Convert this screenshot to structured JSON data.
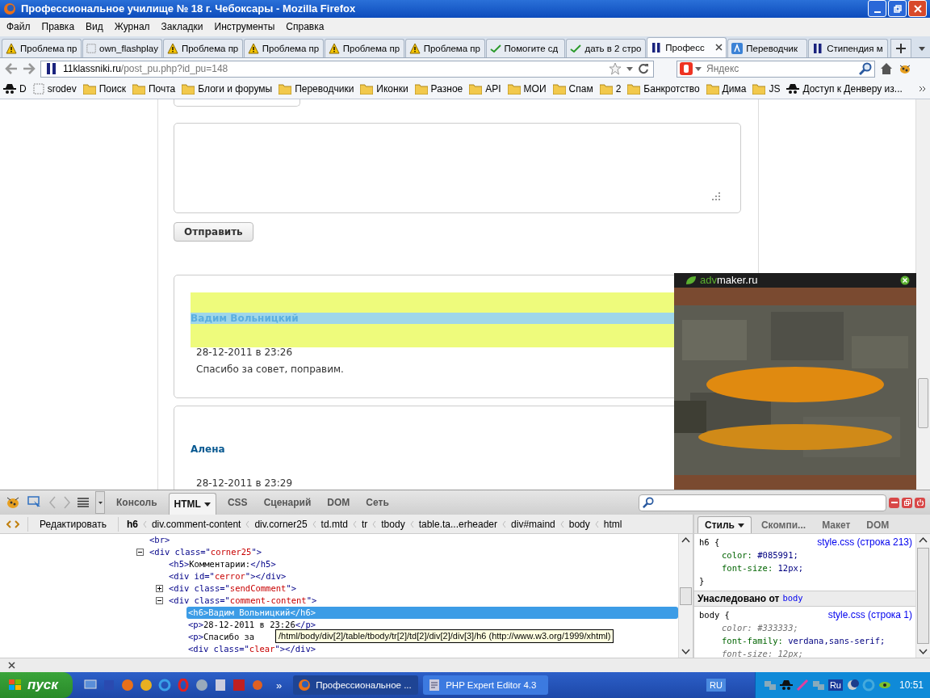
{
  "window": {
    "title": "Профессиональное училище № 18 г. Чебоксары - Mozilla Firefox"
  },
  "menu": [
    "Файл",
    "Правка",
    "Вид",
    "Журнал",
    "Закладки",
    "Инструменты",
    "Справка"
  ],
  "tabs": [
    {
      "label": "Проблема пр",
      "kind": "warning",
      "selected": false
    },
    {
      "label": "own_flashplay",
      "kind": "blank",
      "selected": false
    },
    {
      "label": "Проблема пр",
      "kind": "warning",
      "selected": false
    },
    {
      "label": "Проблема пр",
      "kind": "warning",
      "selected": false
    },
    {
      "label": "Проблема пр",
      "kind": "warning",
      "selected": false
    },
    {
      "label": "Проблема пр",
      "kind": "warning",
      "selected": false
    },
    {
      "label": "Помогите сд",
      "kind": "check",
      "selected": false
    },
    {
      "label": "дать в 2 стро",
      "kind": "check",
      "selected": false
    },
    {
      "label": "Професс",
      "kind": "site",
      "selected": true
    },
    {
      "label": "Переводчик",
      "kind": "translate",
      "selected": false
    },
    {
      "label": "Стипендия м",
      "kind": "site",
      "selected": false
    }
  ],
  "address": {
    "host": "11klassniki.ru",
    "path": "/post_pu.php?id_pu=148"
  },
  "search": {
    "placeholder": "Яндекс"
  },
  "bookmarks": [
    {
      "label": "D",
      "kind": "spy"
    },
    {
      "label": "srodev",
      "kind": "blank"
    },
    {
      "label": "Поиск",
      "kind": "folder"
    },
    {
      "label": "Почта",
      "kind": "folder"
    },
    {
      "label": "Блоги и форумы",
      "kind": "folder"
    },
    {
      "label": "Переводчики",
      "kind": "folder"
    },
    {
      "label": "Иконки",
      "kind": "folder"
    },
    {
      "label": "Разное",
      "kind": "folder"
    },
    {
      "label": "API",
      "kind": "folder"
    },
    {
      "label": "МОИ",
      "kind": "folder"
    },
    {
      "label": "Спам",
      "kind": "folder"
    },
    {
      "label": "2",
      "kind": "folder"
    },
    {
      "label": "Банкротство",
      "kind": "folder"
    },
    {
      "label": "Дима",
      "kind": "folder"
    },
    {
      "label": "JS",
      "kind": "folder"
    },
    {
      "label": "Доступ к Денверу из...",
      "kind": "spy"
    }
  ],
  "page": {
    "send_button": "Отправить",
    "comments": [
      {
        "author": "Вадим Вольницкий",
        "date": "28-12-2011 в 23:26",
        "text": "Спасибо за совет, поправим.",
        "highlighted": true
      },
      {
        "author": "Алена",
        "date": "28-12-2011 в 23:29",
        "highlighted": false
      }
    ],
    "ad": {
      "brand": "adv",
      "domain": "maker.ru",
      "kind": "picture"
    }
  },
  "firebug": {
    "panels": [
      {
        "label": "Консоль",
        "selected": false
      },
      {
        "label": "HTML",
        "selected": true
      },
      {
        "label": "CSS",
        "selected": false
      },
      {
        "label": "Сценарий",
        "selected": false
      },
      {
        "label": "DOM",
        "selected": false
      },
      {
        "label": "Сеть",
        "selected": false
      }
    ],
    "edit_button": "Редактировать",
    "crumbs": [
      {
        "label": "h6",
        "selected": true
      },
      {
        "label": "div.comment-content",
        "selected": false
      },
      {
        "label": "div.corner25",
        "selected": false
      },
      {
        "label": "td.mtd",
        "selected": false
      },
      {
        "label": "tr",
        "selected": false
      },
      {
        "label": "tbody",
        "selected": false
      },
      {
        "label": "table.ta...erheader",
        "selected": false
      },
      {
        "label": "div#maind",
        "selected": false
      },
      {
        "label": "body",
        "selected": false
      },
      {
        "label": "html",
        "selected": false
      }
    ],
    "tree": [
      {
        "parts": [
          {
            "kind": "tag",
            "text": "<br>"
          }
        ],
        "selected": false
      },
      {
        "parts": [
          {
            "kind": "tag",
            "text": "<div class=\""
          },
          {
            "kind": "value",
            "text": "corner25"
          },
          {
            "kind": "tag",
            "text": "\">"
          }
        ],
        "expanded": true,
        "selected": false,
        "children": [
          {
            "parts": [
              {
                "kind": "tag",
                "text": "<h5>"
              },
              {
                "kind": "text",
                "text": "Комментарии:"
              },
              {
                "kind": "tag",
                "text": "</h5>"
              }
            ],
            "selected": false
          },
          {
            "parts": [
              {
                "kind": "tag",
                "text": "<div id=\""
              },
              {
                "kind": "value",
                "text": "cerror"
              },
              {
                "kind": "tag",
                "text": "\"></div>"
              }
            ],
            "selected": false
          },
          {
            "parts": [
              {
                "kind": "tag",
                "text": "<div class=\""
              },
              {
                "kind": "value",
                "text": "sendComment"
              },
              {
                "kind": "tag",
                "text": "\">"
              }
            ],
            "expanded": false,
            "selected": false
          },
          {
            "parts": [
              {
                "kind": "tag",
                "text": "<div class=\""
              },
              {
                "kind": "value",
                "text": "comment-content"
              },
              {
                "kind": "tag",
                "text": "\">"
              }
            ],
            "expanded": true,
            "selected": false,
            "children": [
              {
                "parts": [
                  {
                    "kind": "tag",
                    "text": "<h6>"
                  },
                  {
                    "kind": "text",
                    "text": "Вадим Вольницкий"
                  },
                  {
                    "kind": "tag",
                    "text": "</h6>"
                  }
                ],
                "selected": true
              },
              {
                "parts": [
                  {
                    "kind": "tag",
                    "text": "<p>"
                  },
                  {
                    "kind": "text",
                    "text": "28-12-2011 в 23:26"
                  },
                  {
                    "kind": "tag",
                    "text": "</p>"
                  }
                ],
                "selected": false
              },
              {
                "parts": [
                  {
                    "kind": "tag",
                    "text": "<p>"
                  },
                  {
                    "kind": "text",
                    "text": "Спасибо за"
                  }
                ],
                "selected": false
              },
              {
                "parts": [
                  {
                    "kind": "tag",
                    "text": "<div class=\""
                  },
                  {
                    "kind": "value",
                    "text": "clear"
                  },
                  {
                    "kind": "tag",
                    "text": "\"></div>"
                  }
                ],
                "selected": false
              }
            ]
          }
        ]
      }
    ],
    "tooltip": "/html/body/div[2]/table/tbody/tr[2]/td[2]/div[2]/div[3]/h6 (http://www.w3.org/1999/xhtml)",
    "side_tabs": [
      {
        "label": "Стиль",
        "selected": true
      },
      {
        "label": "Скомпи...",
        "selected": false
      },
      {
        "label": "Макет",
        "selected": false
      },
      {
        "label": "DOM",
        "selected": false
      }
    ],
    "rules": [
      {
        "selector": "h6 {",
        "source": "style.css (строка 213)",
        "properties": [
          {
            "name": "color:",
            "value": "#085991;",
            "overridden": false
          },
          {
            "name": "font-size:",
            "value": "12px;",
            "overridden": false
          }
        ],
        "close": "}"
      }
    ],
    "inherited": {
      "label": "Унаследовано от",
      "element": "body"
    },
    "inherited_rules": [
      {
        "selector": "body {",
        "source": "style.css (строка 1)",
        "properties": [
          {
            "name": "color:",
            "value": "#333333;",
            "overridden": true
          },
          {
            "name": "font-family:",
            "value": "verdana,sans-serif;",
            "overridden": false
          },
          {
            "name": "font-size:",
            "value": "12px;",
            "overridden": true
          }
        ]
      }
    ]
  },
  "taskbar": {
    "start": "пуск",
    "overflow": "»",
    "tasks": [
      {
        "label": "Профессиональное ...",
        "kind": "browser",
        "selected": true
      },
      {
        "label": "PHP Expert Editor 4.3",
        "kind": "editor",
        "selected": false
      }
    ],
    "language": "RU",
    "tray_language": "Ru",
    "clock": "10:51"
  }
}
